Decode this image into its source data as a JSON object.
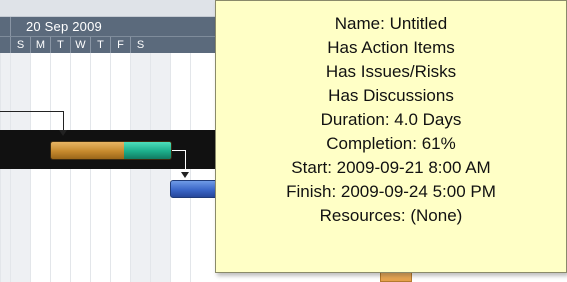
{
  "timeline": {
    "week_label": "20 Sep 2009",
    "days": [
      "S",
      "M",
      "T",
      "W",
      "T",
      "F",
      "S"
    ]
  },
  "colors": {
    "header_bg": "#5b6a7c",
    "task_bar": "#c68a2d",
    "progress_bar": "#1cae8a",
    "successor_bar": "#3b67c8",
    "tooltip_bg": "#ffffc6"
  },
  "task": {
    "completion_percent": 61
  },
  "tooltip": {
    "lines": [
      "Name: Untitled",
      "Has Action Items",
      "Has Issues/Risks",
      "Has Discussions",
      "Duration: 4.0 Days",
      "Completion: 61%",
      "Start: 2009-09-21 8:00 AM",
      "Finish: 2009-09-24 5:00 PM",
      "Resources: (None)"
    ]
  }
}
